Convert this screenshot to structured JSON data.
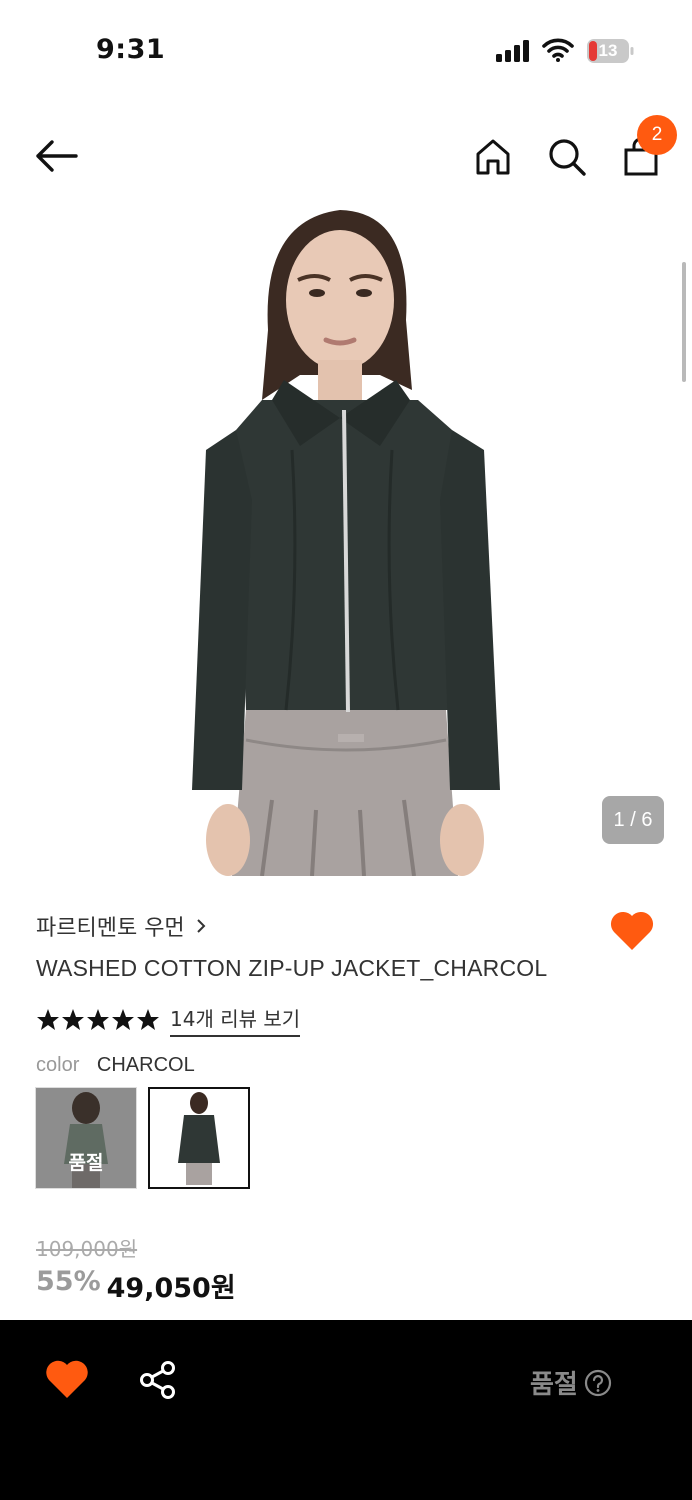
{
  "status_bar": {
    "time": "9:31",
    "battery": "13"
  },
  "header": {
    "back_icon": "arrow-left-icon",
    "home_icon": "home-icon",
    "search_icon": "search-icon",
    "bag_icon": "shopping-bag-icon",
    "cart_count": "2"
  },
  "gallery": {
    "counter": "1 / 6"
  },
  "product": {
    "brand": "파르티멘토 우먼",
    "name": "WASHED COTTON ZIP-UP JACKET_CHARCOL",
    "rating_stars": 5,
    "review_link": "14개 리뷰 보기",
    "color_label": "color",
    "color_value": "CHARCOL",
    "swatches": [
      {
        "label": "품절"
      },
      {
        "label": ""
      }
    ],
    "original_price": "109,000원",
    "discount": "55%",
    "sale_price": "49,050원"
  },
  "bottom_bar": {
    "soldout_label": "품절",
    "help_icon": "question-circle-icon",
    "share_icon": "share-icon",
    "heart_icon": "heart-icon"
  },
  "colors": {
    "accent": "#ff5a10",
    "bottom_bar": "#000000",
    "jacket": "#2f3735",
    "skirt": "#a9a2a0"
  }
}
